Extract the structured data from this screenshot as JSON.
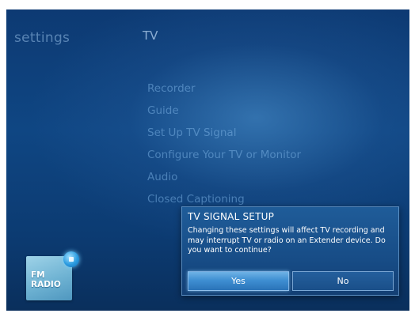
{
  "header": {
    "section": "settings",
    "page_title": "TV"
  },
  "menu": {
    "items": [
      {
        "label": "Recorder"
      },
      {
        "label": "Guide"
      },
      {
        "label": "Set Up TV Signal"
      },
      {
        "label": "Configure Your TV or Monitor"
      },
      {
        "label": "Audio"
      },
      {
        "label": "Closed Captioning"
      }
    ]
  },
  "now_playing_tile": {
    "label_line1": "FM",
    "label_line2": "RADIO",
    "badge_icon": "stop-icon"
  },
  "dialog": {
    "title": "TV SIGNAL SETUP",
    "message": "Changing these settings will affect TV recording and may interrupt TV or radio on an Extender device. Do you want to continue?",
    "yes_label": "Yes",
    "no_label": "No",
    "focused_button": "Yes"
  },
  "colors": {
    "background": "#0f4683",
    "dialog_background": "#174c86",
    "focused_button": "#3f8fd2",
    "text": "#ffffff"
  }
}
